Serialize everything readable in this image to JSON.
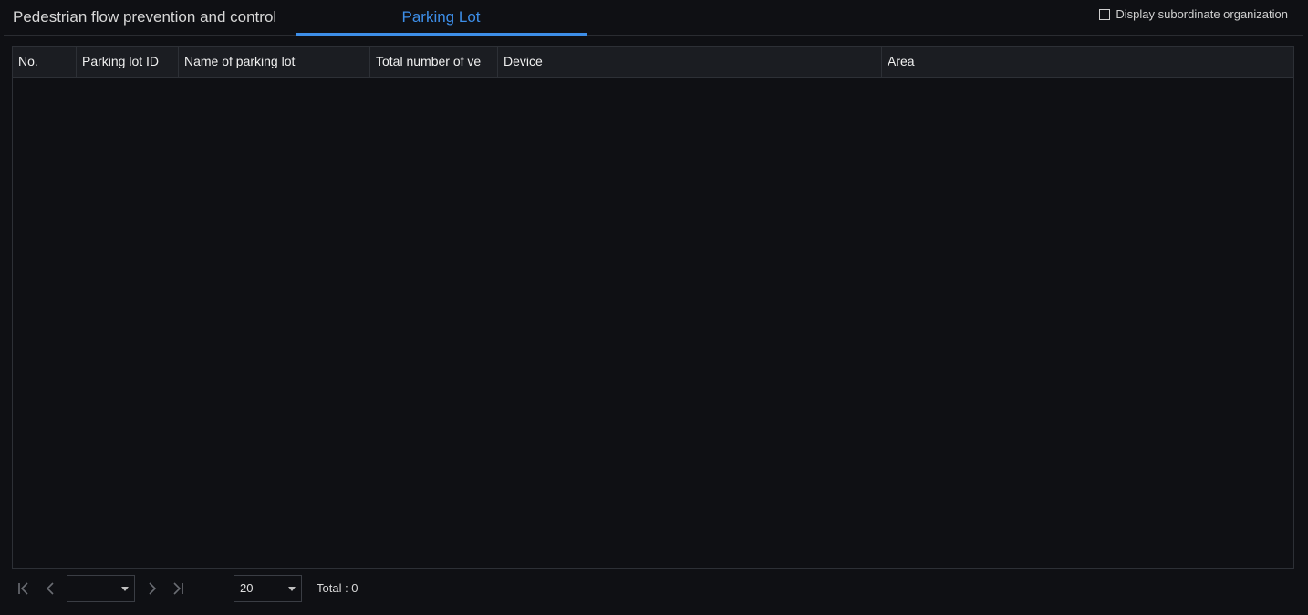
{
  "tabs": {
    "pedestrian_label": "Pedestrian flow prevention and control",
    "parking_label": "Parking Lot",
    "active": "Parking Lot"
  },
  "options": {
    "display_subordinate_label": "Display subordinate organization",
    "display_subordinate_checked": false
  },
  "table": {
    "columns": [
      "No.",
      "Parking lot ID",
      "Name of parking lot",
      "Total number of ve",
      "Device",
      "Area"
    ],
    "rows": []
  },
  "pagination": {
    "current_page": "",
    "page_size": "20",
    "total_text": "Total : 0"
  },
  "colors": {
    "background": "#0f1014",
    "header_background": "#1b1d22",
    "accent": "#3d8ee8",
    "border": "#2d3036"
  },
  "icons": {
    "first": "first-page-icon",
    "prev": "prev-page-icon",
    "next": "next-page-icon",
    "last": "last-page-icon",
    "dropdown": "chevron-down-icon"
  }
}
